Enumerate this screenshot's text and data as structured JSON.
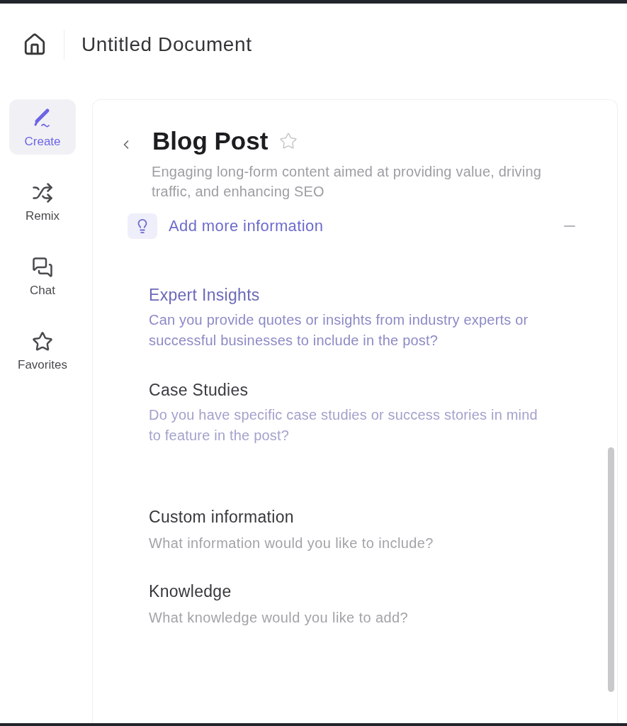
{
  "header": {
    "title": "Untitled Document"
  },
  "sidebar": {
    "items": [
      {
        "label": "Create",
        "kind": "create",
        "selected": true
      },
      {
        "label": "Remix",
        "kind": "remix",
        "selected": false
      },
      {
        "label": "Chat",
        "kind": "chat",
        "selected": false
      },
      {
        "label": "Favorites",
        "kind": "favorites",
        "selected": false
      }
    ]
  },
  "panel": {
    "title": "Blog Post",
    "favorite": false,
    "subtitle": "Engaging long-form content aimed at providing value, driving traffic, and enhancing SEO",
    "add_more": {
      "label": "Add more information",
      "expanded": true
    },
    "suggestions": [
      {
        "title": "Expert Insights",
        "question": "Can you provide quotes or insights from industry experts or successful businesses to include in the post?",
        "selected": true
      },
      {
        "title": "Case Studies",
        "question": "Do you have specific case studies or success stories in mind to feature in the post?",
        "selected": false
      }
    ],
    "fields": [
      {
        "label": "Custom information",
        "placeholder": "What information would you like to include?"
      },
      {
        "label": "Knowledge",
        "placeholder": "What knowledge would you like to add?"
      }
    ]
  }
}
